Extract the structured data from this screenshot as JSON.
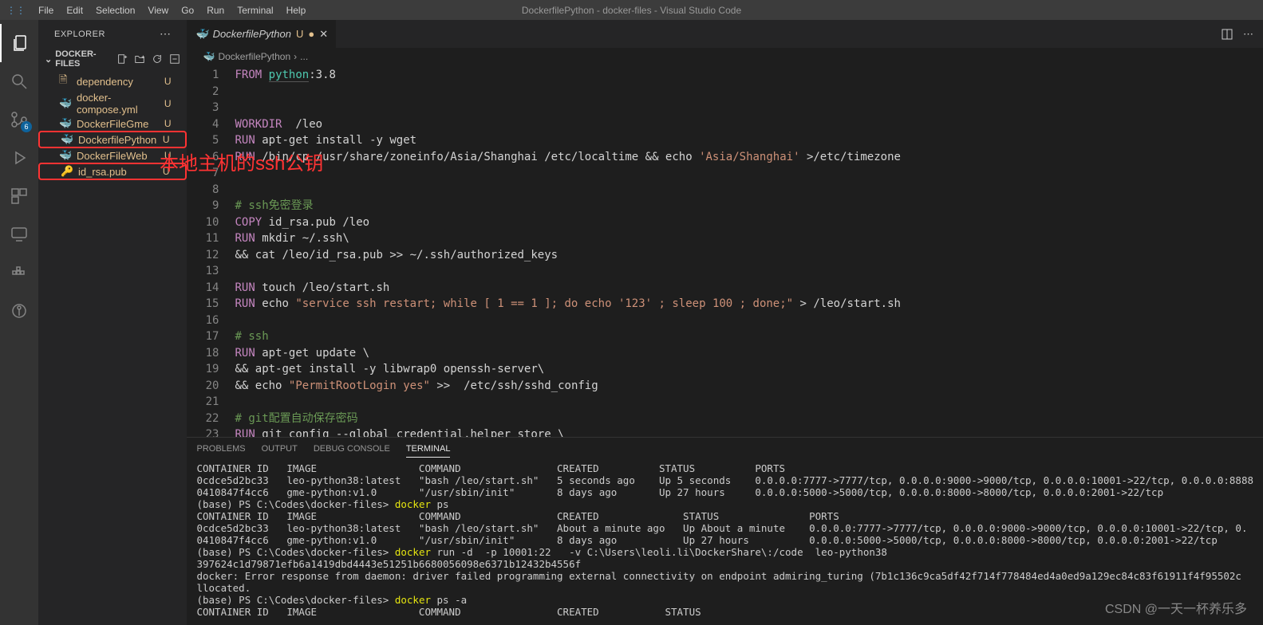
{
  "menu": {
    "items": [
      "File",
      "Edit",
      "Selection",
      "View",
      "Go",
      "Run",
      "Terminal",
      "Help"
    ],
    "title": "DockerfilePython - docker-files - Visual Studio Code"
  },
  "activity": {
    "scm_badge": "6"
  },
  "sidebar": {
    "title": "EXPLORER",
    "section": "DOCKER-FILES",
    "files": [
      {
        "name": "dependency",
        "status": "U",
        "modified": true,
        "type": "file"
      },
      {
        "name": "docker-compose.yml",
        "status": "U",
        "modified": true,
        "type": "docker"
      },
      {
        "name": "DockerFileGme",
        "status": "U",
        "modified": true,
        "type": "docker"
      },
      {
        "name": "DockerfilePython",
        "status": "U",
        "modified": true,
        "type": "docker",
        "boxed": true
      },
      {
        "name": "DockerFileWeb",
        "status": "U",
        "modified": true,
        "type": "docker"
      },
      {
        "name": "id_rsa.pub",
        "status": "U",
        "modified": true,
        "type": "key",
        "boxed": true
      }
    ]
  },
  "annotation": "本地主机的ssh公钥",
  "tabs": {
    "active": {
      "name": "DockerfilePython",
      "status": "U"
    },
    "breadcrumb": [
      "DockerfilePython",
      "..."
    ]
  },
  "editor": {
    "lines": [
      {
        "n": 1,
        "html": "<span class='kw'>FROM</span> <span class='type' style='border-bottom:1px solid #555'>python</span>:3.8"
      },
      {
        "n": 2,
        "html": ""
      },
      {
        "n": 3,
        "html": ""
      },
      {
        "n": 4,
        "html": "<span class='kw'>WORKDIR</span>  /leo"
      },
      {
        "n": 5,
        "html": "<span class='kw'>RUN</span> apt-get install -y wget"
      },
      {
        "n": 6,
        "html": "<span class='kw'>RUN</span> /bin/cp /usr/share/zoneinfo/Asia/Shanghai /etc/localtime && echo <span class='str'>'Asia/Shanghai'</span> >/etc/timezone"
      },
      {
        "n": 7,
        "html": ""
      },
      {
        "n": 8,
        "html": ""
      },
      {
        "n": 9,
        "html": "<span class='com'># ssh免密登录</span>"
      },
      {
        "n": 10,
        "html": "<span class='kw'>COPY</span> id_rsa.pub /leo"
      },
      {
        "n": 11,
        "html": "<span class='kw'>RUN</span> mkdir ~/.ssh\\"
      },
      {
        "n": 12,
        "html": "&& cat /leo/id_rsa.pub >> ~/.ssh/authorized_keys"
      },
      {
        "n": 13,
        "html": ""
      },
      {
        "n": 14,
        "html": "<span class='kw'>RUN</span> touch /leo/start.sh"
      },
      {
        "n": 15,
        "html": "<span class='kw'>RUN</span> echo <span class='str'>\"service ssh restart; while [ 1 == 1 ]; do echo '123' ; sleep 100 ; done;\"</span> > /leo/start.sh"
      },
      {
        "n": 16,
        "html": ""
      },
      {
        "n": 17,
        "html": "<span class='com'># ssh</span>"
      },
      {
        "n": 18,
        "html": "<span class='kw'>RUN</span> apt-get update \\"
      },
      {
        "n": 19,
        "html": "&& apt-get install -y libwrap0 openssh-server\\"
      },
      {
        "n": 20,
        "html": "&& echo <span class='str'>\"PermitRootLogin yes\"</span> >>  /etc/ssh/sshd_config"
      },
      {
        "n": 21,
        "html": ""
      },
      {
        "n": 22,
        "html": "<span class='com'># git配置自动保存密码</span>"
      },
      {
        "n": 23,
        "html": "<span class='kw'>RUN</span> git config --global credential.helper store \\"
      }
    ]
  },
  "panel": {
    "tabs": [
      "PROBLEMS",
      "OUTPUT",
      "DEBUG CONSOLE",
      "TERMINAL"
    ],
    "active_tab": "TERMINAL",
    "terminal_raw": "CONTAINER ID   IMAGE                 COMMAND                CREATED          STATUS          PORTS\n0cdce5d2bc33   leo-python38:latest   \"bash /leo/start.sh\"   5 seconds ago    Up 5 seconds    0.0.0.0:7777->7777/tcp, 0.0.0.0:9000->9000/tcp, 0.0.0.0:10001->22/tcp, 0.0.0.0:8888\n0410847f4cc6   gme-python:v1.0       \"/usr/sbin/init\"       8 days ago       Up 27 hours     0.0.0.0:5000->5000/tcp, 0.0.0.0:8000->8000/tcp, 0.0.0.0:2001->22/tcp\n(base) PS C:\\Codes\\docker-files> <span class='term-y'>docker</span> ps\nCONTAINER ID   IMAGE                 COMMAND                CREATED              STATUS               PORTS\n0cdce5d2bc33   leo-python38:latest   \"bash /leo/start.sh\"   About a minute ago   Up About a minute    0.0.0.0:7777->7777/tcp, 0.0.0.0:9000->9000/tcp, 0.0.0.0:10001->22/tcp, 0.\n0410847f4cc6   gme-python:v1.0       \"/usr/sbin/init\"       8 days ago           Up 27 hours          0.0.0.0:5000->5000/tcp, 0.0.0.0:8000->8000/tcp, 0.0.0.0:2001->22/tcp\n(base) PS C:\\Codes\\docker-files> <span class='term-y'>docker</span> run -d  -p 10001:22   -v C:\\Users\\leoli.li\\DockerShare\\:/code  leo-python38\n397624c1d79871efb6a1419dbd4443e51251b6680056098e6371b12432b4556f\ndocker: Error response from daemon: driver failed programming external connectivity on endpoint admiring_turing (7b1c136c9ca5df42f714f778484ed4a0ed9a129ec84c83f61911f4f95502c\nllocated.\n(base) PS C:\\Codes\\docker-files> <span class='term-y'>docker</span> ps -a\nCONTAINER ID   IMAGE                 COMMAND                CREATED           STATUS"
  },
  "watermark": "CSDN @一天一杯养乐多"
}
